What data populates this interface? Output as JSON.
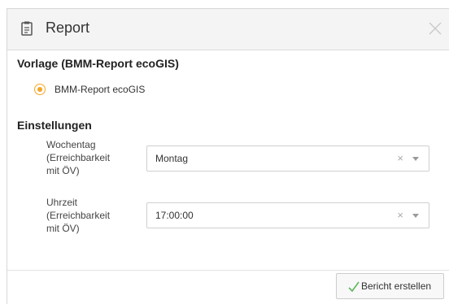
{
  "dialog": {
    "title": "Report",
    "icon": "report-clipboard-icon",
    "close_icon": "close-icon"
  },
  "template_section": {
    "title": "Vorlage (BMM-Report ecoGIS)",
    "options": [
      {
        "label": "BMM-Report ecoGIS",
        "selected": true
      }
    ]
  },
  "settings_section": {
    "title": "Einstellungen",
    "fields": [
      {
        "label_line1": "Wochentag",
        "label_line2": "(Erreichbarkeit",
        "label_line3": "mit ÖV)",
        "value": "Montag",
        "clear": "×"
      },
      {
        "label_line1": "Uhrzeit",
        "label_line2": "(Erreichbarkeit",
        "label_line3": "mit ÖV)",
        "value": "17:00:00",
        "clear": "×"
      }
    ]
  },
  "footer": {
    "create_button_label": "Bericht erstellen",
    "create_button_icon": "check-icon"
  },
  "colors": {
    "accent_orange": "#f5a623",
    "check_green": "#5cb85c"
  }
}
